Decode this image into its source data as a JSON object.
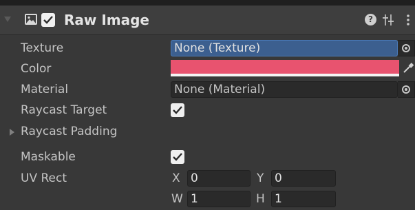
{
  "component": {
    "title": "Raw Image",
    "enabled": true,
    "help_symbol": "?"
  },
  "icons": {
    "fold": "triangle-down-icon",
    "component": "image-icon",
    "enabled": "checkmark-icon",
    "help": "help-icon",
    "presets": "sliders-icon",
    "menu": "kebab-menu-icon",
    "object_picker": "object-picker-icon",
    "eyedropper": "eyedropper-icon",
    "expand": "triangle-right-icon"
  },
  "fields": {
    "texture": {
      "label": "Texture",
      "value": "None (Texture)"
    },
    "color": {
      "label": "Color",
      "value": "#E8536F"
    },
    "material": {
      "label": "Material",
      "value": "None (Material)"
    },
    "raycast_target": {
      "label": "Raycast Target",
      "checked": true
    },
    "raycast_padding": {
      "label": "Raycast Padding"
    },
    "maskable": {
      "label": "Maskable",
      "checked": true
    },
    "uv_rect": {
      "label": "UV Rect",
      "x_label": "X",
      "x": "0",
      "y_label": "Y",
      "y": "0",
      "w_label": "W",
      "w": "1",
      "h_label": "H",
      "h": "1"
    }
  },
  "colors": {
    "background": "#383838",
    "header": "#3E3E3E",
    "selection": "#3C5F8F",
    "field": "#2A2A2A"
  }
}
